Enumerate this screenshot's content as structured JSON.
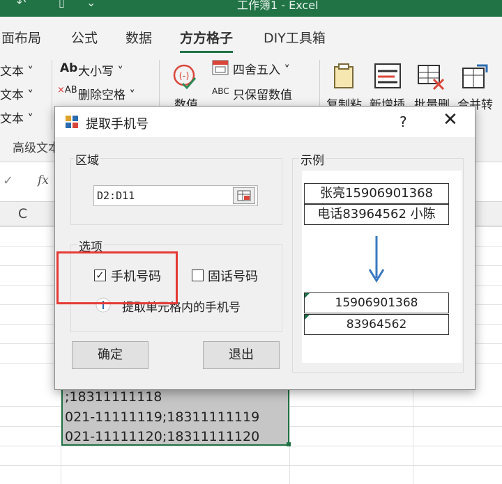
{
  "window": {
    "title": "工作簿1 - Excel"
  },
  "tabs": [
    "面布局",
    "公式",
    "数据",
    "方方格子",
    "DIY工具箱"
  ],
  "active_tab": "方方格子",
  "ribbon": {
    "left_items": [
      "文本 ˅",
      "文本 ˅",
      "文本 ˅"
    ],
    "group_label": "高级文本",
    "size_case": "大小写 ˅",
    "remove_space": "删除空格 ˅",
    "numeric_label": "数值",
    "round": "四舍五入 ˅",
    "keep_number": "只保留数值",
    "copy_paste": "复制粘",
    "new_insert": "新增插",
    "batch_delete": "批量删",
    "merge_convert": "合并转"
  },
  "formula_bar": {
    "fx": "fx"
  },
  "columns": {
    "c": "C"
  },
  "sheet_rows": [
    ";18311111118",
    "021-11111119;18311111119",
    "021-11111120;18311111120"
  ],
  "dialog": {
    "title": "提取手机号",
    "help": "?",
    "close": "✕",
    "region_label": "区域",
    "range_value": "D2:D11",
    "options_label": "选项",
    "mobile_checkbox": {
      "label": "手机号码",
      "checked": true
    },
    "landline_checkbox": {
      "label": "固话号码",
      "checked": false
    },
    "hint": "提取单元格内的手机号",
    "ok_button": "确定",
    "exit_button": "退出",
    "example_label": "示例",
    "example_inputs": [
      "张亮15906901368",
      "电话83964562 小陈"
    ],
    "example_outputs": [
      "15906901368",
      "83964562"
    ]
  },
  "colors": {
    "excel_green": "#217346",
    "highlight_red": "#e53935",
    "arrow_blue": "#3a78c2"
  }
}
